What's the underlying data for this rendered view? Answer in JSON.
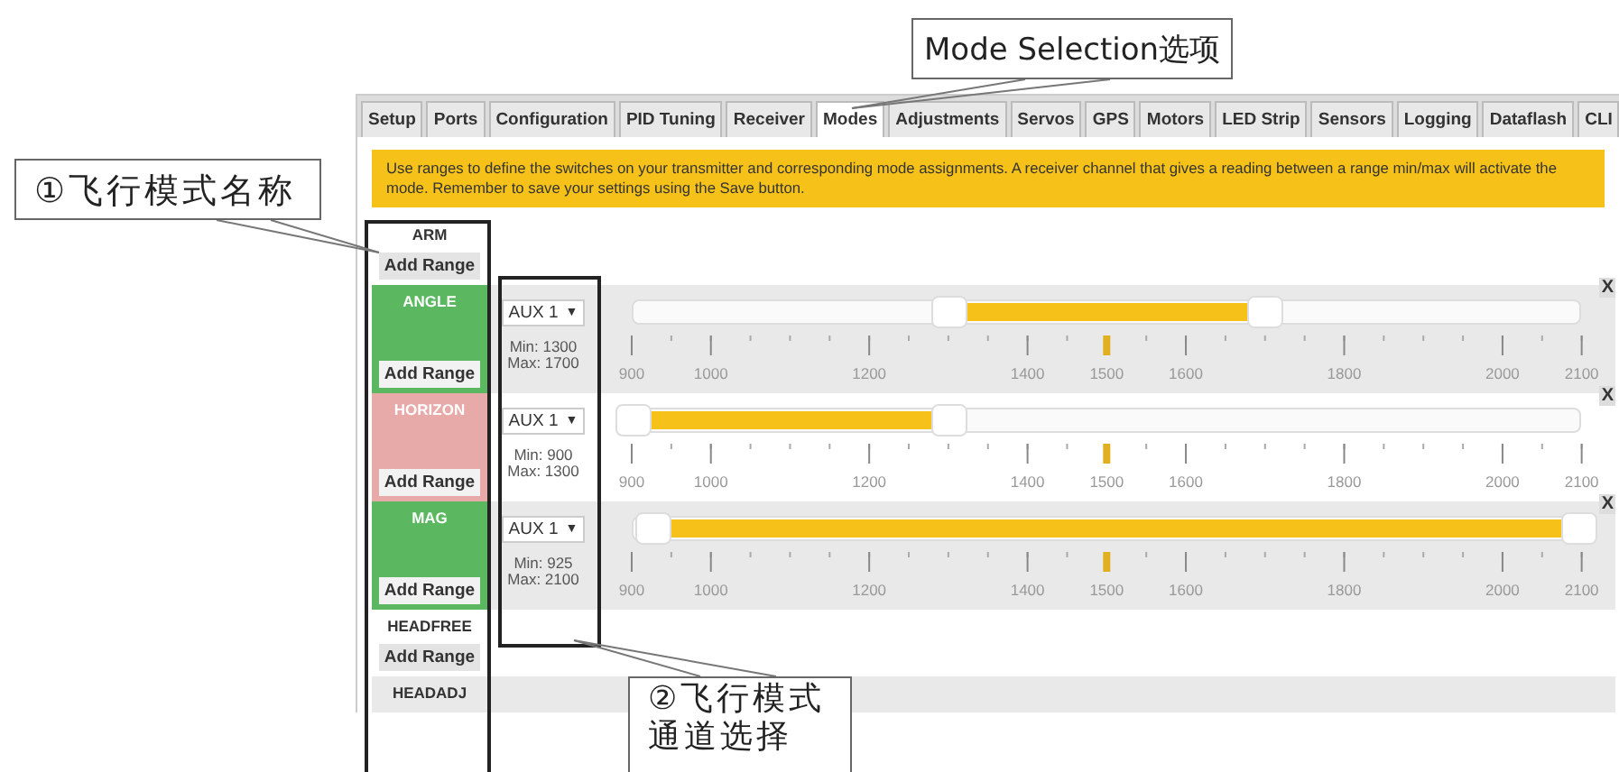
{
  "annotations": [
    {
      "kind": "title",
      "lines": [
        "Mode Selection选项"
      ]
    },
    {
      "kind": "names",
      "lines": [
        "①飞行模式名称"
      ]
    },
    {
      "kind": "channels",
      "lines": [
        "②飞行模式",
        "通道选择"
      ]
    }
  ],
  "tabs": [
    {
      "label": "Setup",
      "selected": false
    },
    {
      "label": "Ports",
      "selected": false
    },
    {
      "label": "Configuration",
      "selected": false
    },
    {
      "label": "PID Tuning",
      "selected": false
    },
    {
      "label": "Receiver",
      "selected": false
    },
    {
      "label": "Modes",
      "selected": true
    },
    {
      "label": "Adjustments",
      "selected": false
    },
    {
      "label": "Servos",
      "selected": false
    },
    {
      "label": "GPS",
      "selected": false
    },
    {
      "label": "Motors",
      "selected": false
    },
    {
      "label": "LED Strip",
      "selected": false
    },
    {
      "label": "Sensors",
      "selected": false
    },
    {
      "label": "Logging",
      "selected": false
    },
    {
      "label": "Dataflash",
      "selected": false
    },
    {
      "label": "CLI",
      "selected": false
    }
  ],
  "banner": "Use ranges to define the switches on your transmitter and corresponding mode assignments. A receiver channel that gives a reading between a range min/max will activate the mode. Remember to save your settings using the Save button.",
  "modes": [
    {
      "name": "ARM",
      "add_range": "Add Range"
    },
    {
      "name": "ANGLE",
      "color": "#5cb860",
      "add_range": "Add Range",
      "ranges": [
        {
          "channel": "AUX 1",
          "caret": "▼",
          "min": "Min: 1300",
          "max": "Max: 1700",
          "handles": [
            {
              "level": 0.333
            },
            {
              "level": 0.667
            }
          ],
          "marker": {
            "level": 0.5
          },
          "remove": "X",
          "scale": [
            "900",
            "1000",
            "1200",
            "1400",
            "1500",
            "1600",
            "1800",
            "2000",
            "2100"
          ]
        }
      ]
    },
    {
      "name": "HORIZON",
      "color": "#e8a9a9",
      "add_range": "Add Range",
      "ranges": [
        {
          "channel": "AUX 1",
          "caret": "▼",
          "min": "Min: 900",
          "max": "Max: 1300",
          "handles": [
            {
              "level": 0
            },
            {
              "level": 0.333
            }
          ],
          "marker": {
            "level": 0.5
          },
          "remove": "X",
          "scale": [
            "900",
            "1000",
            "1200",
            "1400",
            "1500",
            "1600",
            "1800",
            "2000",
            "2100"
          ]
        }
      ]
    },
    {
      "name": "MAG",
      "color": "#5cb860",
      "add_range": "Add Range",
      "ranges": [
        {
          "channel": "AUX 1",
          "caret": "▼",
          "min": "Min: 925",
          "max": "Max: 2100",
          "handles": [
            {
              "level": 0.0208
            },
            {
              "level": 1
            }
          ],
          "marker": {
            "level": 0.5
          },
          "remove": "X",
          "scale": [
            "900",
            "1000",
            "1200",
            "1400",
            "1500",
            "1600",
            "1800",
            "2000",
            "2100"
          ]
        }
      ]
    },
    {
      "name": "HEADFREE",
      "add_range": "Add Range"
    },
    {
      "name": "HEADADJ"
    }
  ]
}
